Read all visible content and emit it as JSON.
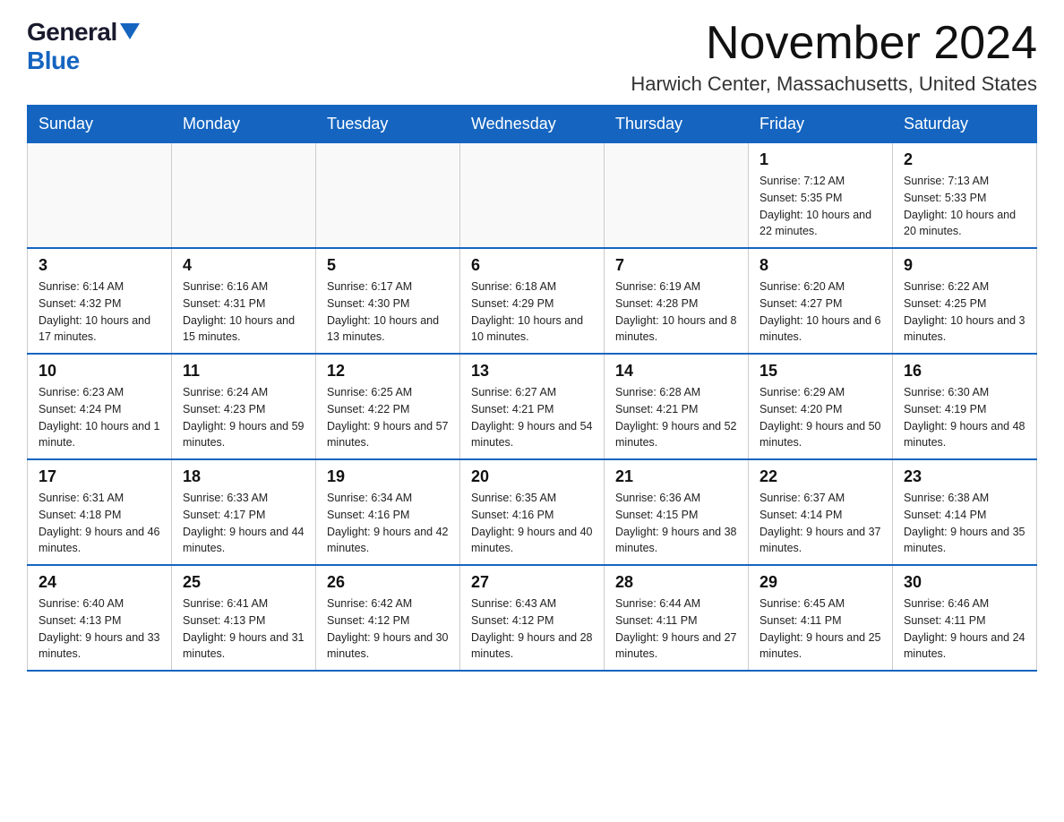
{
  "logo": {
    "general": "General",
    "blue": "Blue"
  },
  "header": {
    "month_title": "November 2024",
    "location": "Harwich Center, Massachusetts, United States"
  },
  "weekdays": [
    "Sunday",
    "Monday",
    "Tuesday",
    "Wednesday",
    "Thursday",
    "Friday",
    "Saturday"
  ],
  "rows": [
    [
      {
        "day": "",
        "info": ""
      },
      {
        "day": "",
        "info": ""
      },
      {
        "day": "",
        "info": ""
      },
      {
        "day": "",
        "info": ""
      },
      {
        "day": "",
        "info": ""
      },
      {
        "day": "1",
        "info": "Sunrise: 7:12 AM\nSunset: 5:35 PM\nDaylight: 10 hours and 22 minutes."
      },
      {
        "day": "2",
        "info": "Sunrise: 7:13 AM\nSunset: 5:33 PM\nDaylight: 10 hours and 20 minutes."
      }
    ],
    [
      {
        "day": "3",
        "info": "Sunrise: 6:14 AM\nSunset: 4:32 PM\nDaylight: 10 hours and 17 minutes."
      },
      {
        "day": "4",
        "info": "Sunrise: 6:16 AM\nSunset: 4:31 PM\nDaylight: 10 hours and 15 minutes."
      },
      {
        "day": "5",
        "info": "Sunrise: 6:17 AM\nSunset: 4:30 PM\nDaylight: 10 hours and 13 minutes."
      },
      {
        "day": "6",
        "info": "Sunrise: 6:18 AM\nSunset: 4:29 PM\nDaylight: 10 hours and 10 minutes."
      },
      {
        "day": "7",
        "info": "Sunrise: 6:19 AM\nSunset: 4:28 PM\nDaylight: 10 hours and 8 minutes."
      },
      {
        "day": "8",
        "info": "Sunrise: 6:20 AM\nSunset: 4:27 PM\nDaylight: 10 hours and 6 minutes."
      },
      {
        "day": "9",
        "info": "Sunrise: 6:22 AM\nSunset: 4:25 PM\nDaylight: 10 hours and 3 minutes."
      }
    ],
    [
      {
        "day": "10",
        "info": "Sunrise: 6:23 AM\nSunset: 4:24 PM\nDaylight: 10 hours and 1 minute."
      },
      {
        "day": "11",
        "info": "Sunrise: 6:24 AM\nSunset: 4:23 PM\nDaylight: 9 hours and 59 minutes."
      },
      {
        "day": "12",
        "info": "Sunrise: 6:25 AM\nSunset: 4:22 PM\nDaylight: 9 hours and 57 minutes."
      },
      {
        "day": "13",
        "info": "Sunrise: 6:27 AM\nSunset: 4:21 PM\nDaylight: 9 hours and 54 minutes."
      },
      {
        "day": "14",
        "info": "Sunrise: 6:28 AM\nSunset: 4:21 PM\nDaylight: 9 hours and 52 minutes."
      },
      {
        "day": "15",
        "info": "Sunrise: 6:29 AM\nSunset: 4:20 PM\nDaylight: 9 hours and 50 minutes."
      },
      {
        "day": "16",
        "info": "Sunrise: 6:30 AM\nSunset: 4:19 PM\nDaylight: 9 hours and 48 minutes."
      }
    ],
    [
      {
        "day": "17",
        "info": "Sunrise: 6:31 AM\nSunset: 4:18 PM\nDaylight: 9 hours and 46 minutes."
      },
      {
        "day": "18",
        "info": "Sunrise: 6:33 AM\nSunset: 4:17 PM\nDaylight: 9 hours and 44 minutes."
      },
      {
        "day": "19",
        "info": "Sunrise: 6:34 AM\nSunset: 4:16 PM\nDaylight: 9 hours and 42 minutes."
      },
      {
        "day": "20",
        "info": "Sunrise: 6:35 AM\nSunset: 4:16 PM\nDaylight: 9 hours and 40 minutes."
      },
      {
        "day": "21",
        "info": "Sunrise: 6:36 AM\nSunset: 4:15 PM\nDaylight: 9 hours and 38 minutes."
      },
      {
        "day": "22",
        "info": "Sunrise: 6:37 AM\nSunset: 4:14 PM\nDaylight: 9 hours and 37 minutes."
      },
      {
        "day": "23",
        "info": "Sunrise: 6:38 AM\nSunset: 4:14 PM\nDaylight: 9 hours and 35 minutes."
      }
    ],
    [
      {
        "day": "24",
        "info": "Sunrise: 6:40 AM\nSunset: 4:13 PM\nDaylight: 9 hours and 33 minutes."
      },
      {
        "day": "25",
        "info": "Sunrise: 6:41 AM\nSunset: 4:13 PM\nDaylight: 9 hours and 31 minutes."
      },
      {
        "day": "26",
        "info": "Sunrise: 6:42 AM\nSunset: 4:12 PM\nDaylight: 9 hours and 30 minutes."
      },
      {
        "day": "27",
        "info": "Sunrise: 6:43 AM\nSunset: 4:12 PM\nDaylight: 9 hours and 28 minutes."
      },
      {
        "day": "28",
        "info": "Sunrise: 6:44 AM\nSunset: 4:11 PM\nDaylight: 9 hours and 27 minutes."
      },
      {
        "day": "29",
        "info": "Sunrise: 6:45 AM\nSunset: 4:11 PM\nDaylight: 9 hours and 25 minutes."
      },
      {
        "day": "30",
        "info": "Sunrise: 6:46 AM\nSunset: 4:11 PM\nDaylight: 9 hours and 24 minutes."
      }
    ]
  ]
}
